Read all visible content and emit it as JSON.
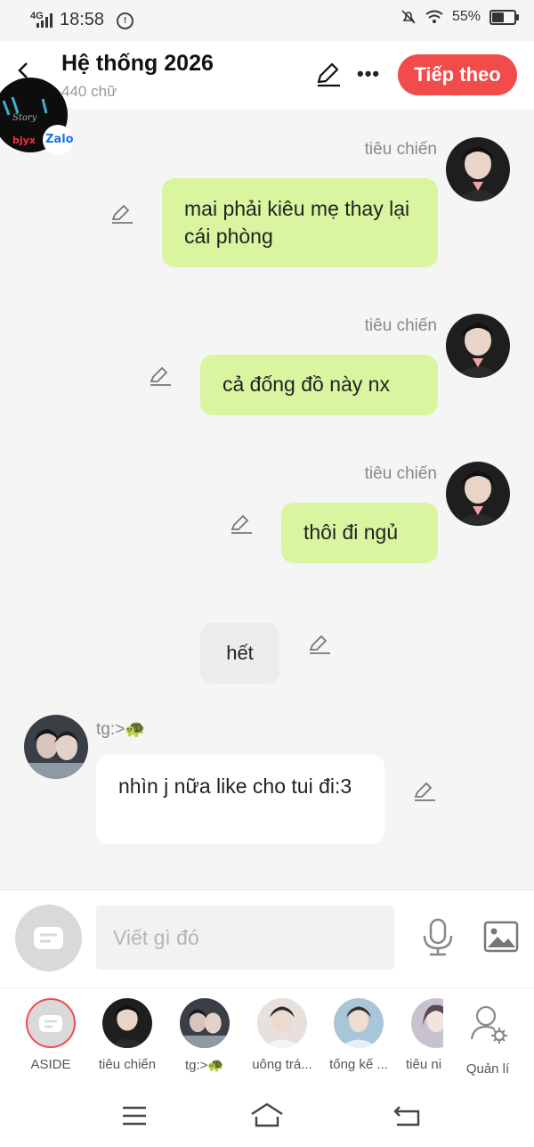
{
  "status_bar": {
    "network": "4G",
    "time": "18:58",
    "battery": "55%",
    "battery_level": 0.55
  },
  "header": {
    "title": "Hệ thống 2026",
    "subtitle": "440 chữ",
    "next_label": "Tiếp theo"
  },
  "floating_badge": {
    "text": "Zalo"
  },
  "messages": [
    {
      "speaker": "tiêu chiến",
      "text": "mai phải kiêu mẹ thay lại cái phòng"
    },
    {
      "speaker": "tiêu chiến",
      "text": "cả đống đồ này nx"
    },
    {
      "speaker": "tiêu chiến",
      "text": "thôi đi ngủ"
    },
    {
      "speaker": "",
      "text": "hết"
    },
    {
      "speaker": "tg:>🐢",
      "text": "nhìn j nữa like cho tui đi:3"
    }
  ],
  "composer": {
    "placeholder": "Viết gì đó"
  },
  "characters": [
    {
      "label": "ASIDE"
    },
    {
      "label": "tiêu chiến"
    },
    {
      "label": "tg:>🐢"
    },
    {
      "label": "uông trá..."
    },
    {
      "label": "tống kế ..."
    },
    {
      "label": "tiêu ni"
    },
    {
      "label": "Quản lí"
    }
  ],
  "colors": {
    "accent": "#f24b4b",
    "sent_bubble": "#d9f5a0",
    "background": "#f5f5f5"
  }
}
